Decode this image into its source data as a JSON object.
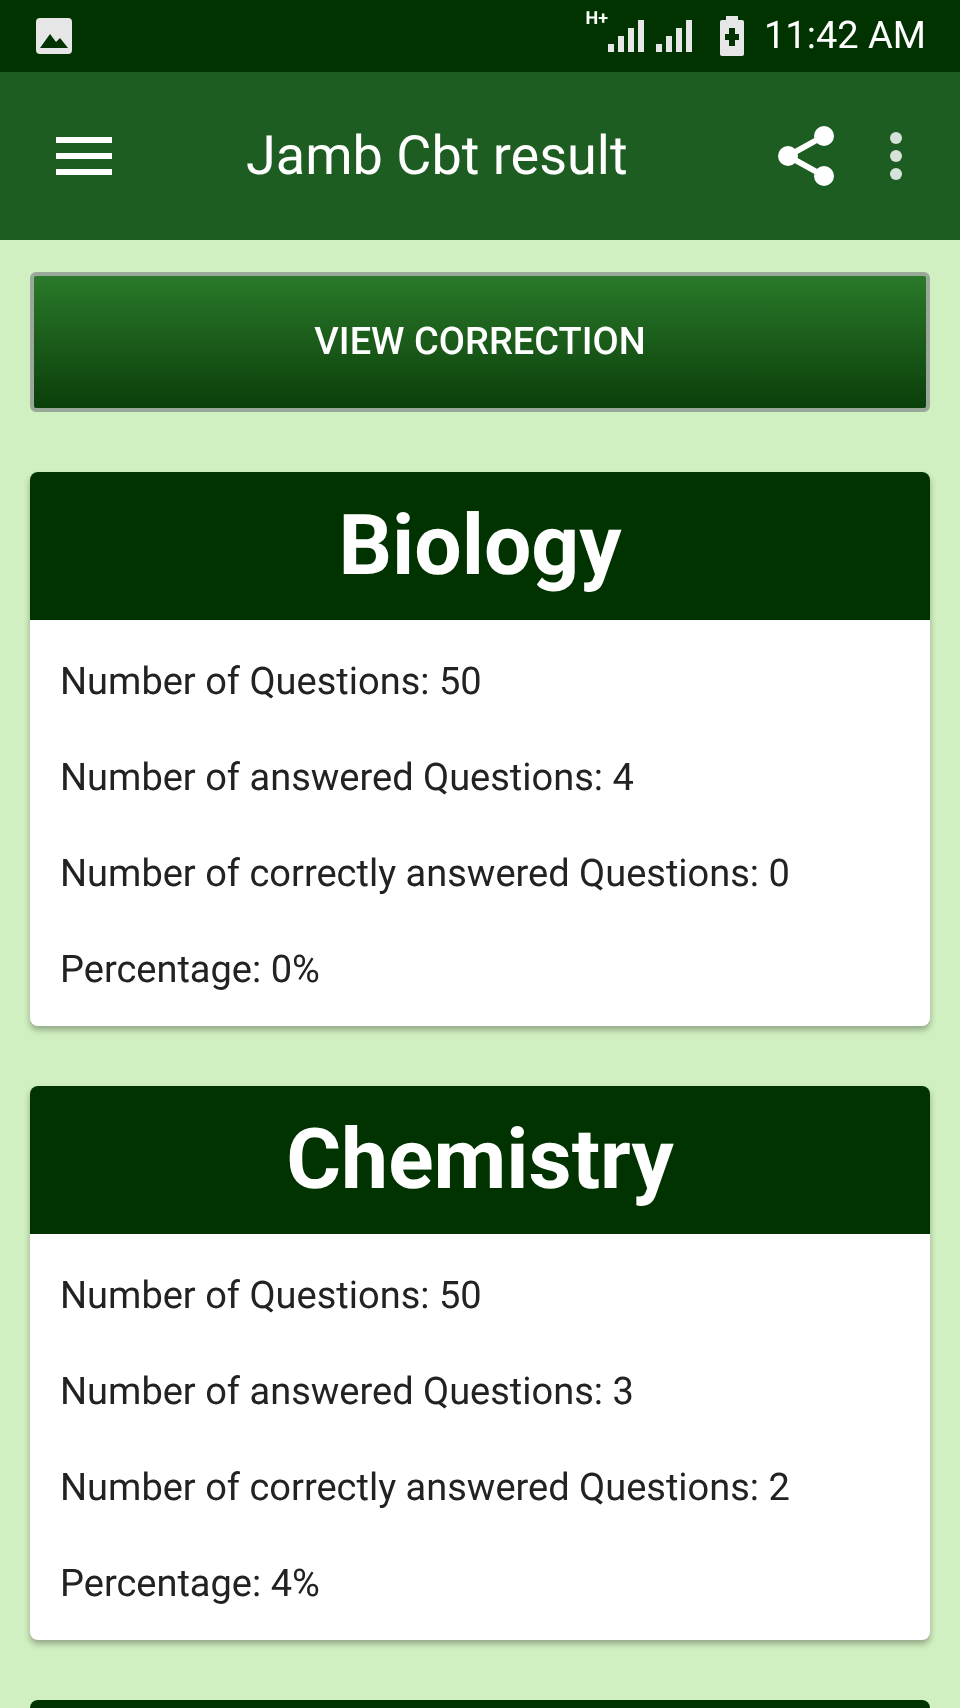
{
  "status_bar": {
    "time": "11:42 AM",
    "network": "H+"
  },
  "toolbar": {
    "title": "Jamb Cbt result"
  },
  "view_button": {
    "label": "VIEW CORRECTION"
  },
  "subjects": [
    {
      "title": "Biology",
      "lines": [
        "Number of Questions: 50",
        "Number of answered Questions: 4",
        "Number of correctly answered Questions: 0",
        "Percentage: 0%"
      ]
    },
    {
      "title": "Chemistry",
      "lines": [
        "Number of Questions: 50",
        "Number of answered Questions: 3",
        "Number of correctly answered Questions: 2",
        "Percentage: 4%"
      ]
    }
  ]
}
